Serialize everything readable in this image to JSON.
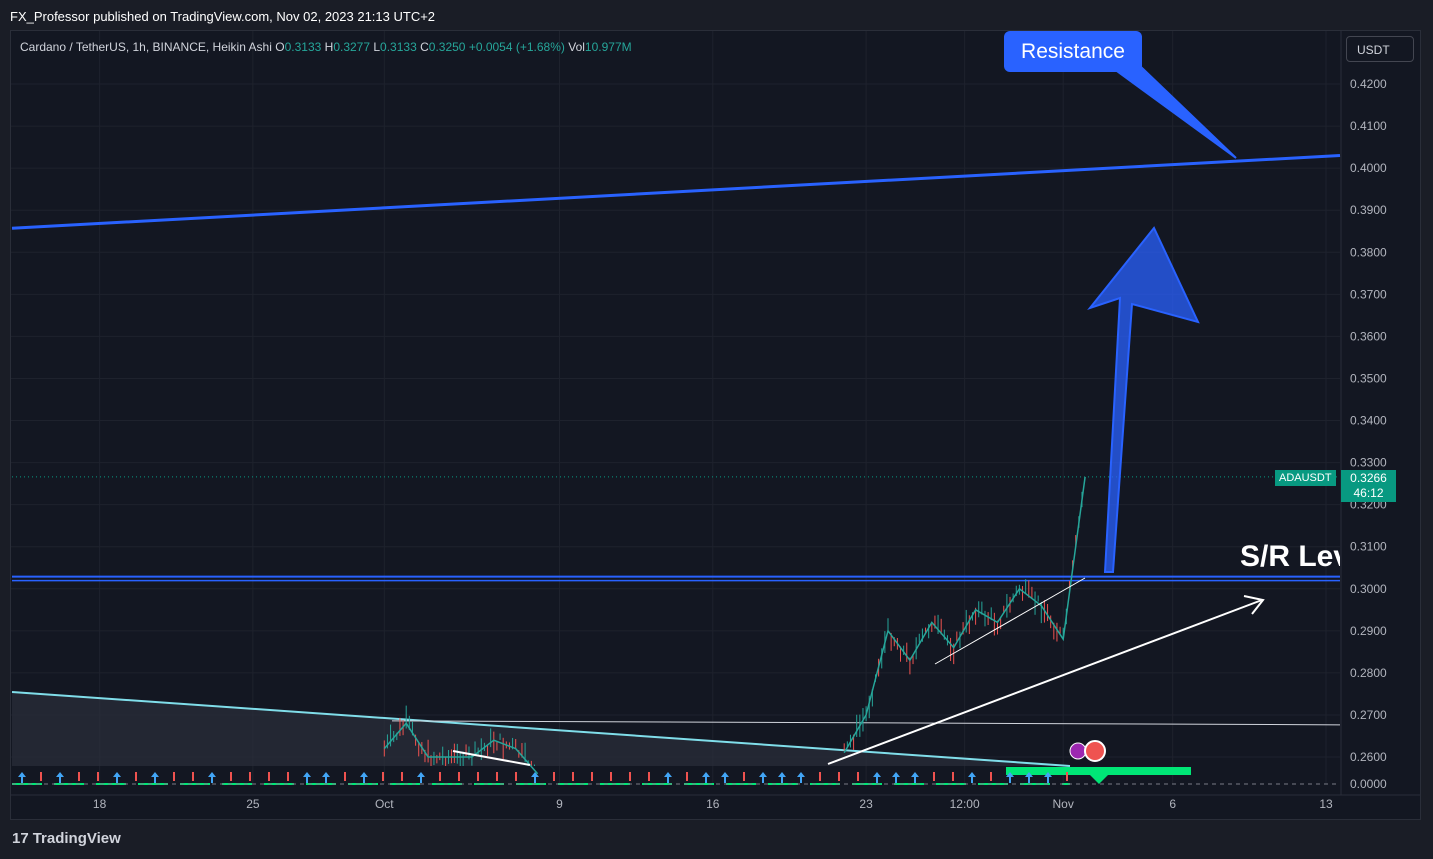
{
  "header": {
    "published_by": "FX_Professor published on TradingView.com, Nov 02, 2023 21:13 UTC+2"
  },
  "legend": {
    "symbol": "Cardano / TetherUS, 1h, BINANCE, Heikin Ashi",
    "o_label": "O",
    "o_value": "0.3133",
    "h_label": "H",
    "h_value": "0.3277",
    "l_label": "L",
    "l_value": "0.3133",
    "c_label": "C",
    "c_value": "0.3250",
    "change": "+0.0054 (+1.68%)",
    "vol_label": "Vol",
    "vol_value": "10.977M"
  },
  "toolbar": {
    "currency": "USDT"
  },
  "footer": {
    "brand": "TradingView",
    "brand_mark": "17"
  },
  "annotations": {
    "resistance": "Resistance",
    "sr_level": "S/R Level"
  },
  "price_tag": {
    "symbol": "ADAUSDT",
    "price": "0.3266",
    "countdown": "46:12"
  },
  "colors": {
    "background": "#131722",
    "up": "#26a69a",
    "down": "#ef5350",
    "resistance_line": "#2962ff",
    "sr_line": "#2962ff",
    "trend_line": "#80deea",
    "axis_text": "#b2b5be"
  },
  "chart_data": {
    "type": "line",
    "title": "Cardano / TetherUS, 1h, BINANCE, Heikin Ashi",
    "y_ticks": [
      "0.4200",
      "0.4100",
      "0.4000",
      "0.3900",
      "0.3800",
      "0.3700",
      "0.3600",
      "0.3500",
      "0.3400",
      "0.3300",
      "0.3200",
      "0.3100",
      "0.3000",
      "0.2900",
      "0.2800",
      "0.2700",
      "0.2600",
      "0.0000"
    ],
    "x_ticks": [
      "18",
      "25",
      "Oct",
      "9",
      "16",
      "23",
      "12:00",
      "Nov",
      "6",
      "13"
    ],
    "ylim": [
      0.255,
      0.428
    ],
    "grid": true,
    "current_price": 0.3266,
    "levels": [
      {
        "name": "Resistance",
        "value_start": 0.3857,
        "value_end": 0.403
      },
      {
        "name": "S/R Level",
        "value": 0.3024
      },
      {
        "value": 0.2686
      }
    ],
    "series": [
      {
        "name": "ADAUSDT",
        "x": [
          "Oct 1",
          "Oct 2",
          "Oct 3",
          "Oct 5",
          "Oct 6",
          "Oct 7",
          "Oct 8",
          "Oct 22",
          "Oct 23",
          "Oct 24",
          "Oct 25",
          "Oct 26",
          "Oct 27",
          "Oct 28",
          "Oct 29",
          "Oct 30",
          "Oct 31",
          "Nov 1",
          "Nov 2"
        ],
        "values": [
          0.262,
          0.268,
          0.26,
          0.26,
          0.264,
          0.262,
          0.256,
          0.261,
          0.27,
          0.29,
          0.283,
          0.292,
          0.286,
          0.295,
          0.292,
          0.3,
          0.296,
          0.288,
          0.3266
        ]
      }
    ]
  }
}
